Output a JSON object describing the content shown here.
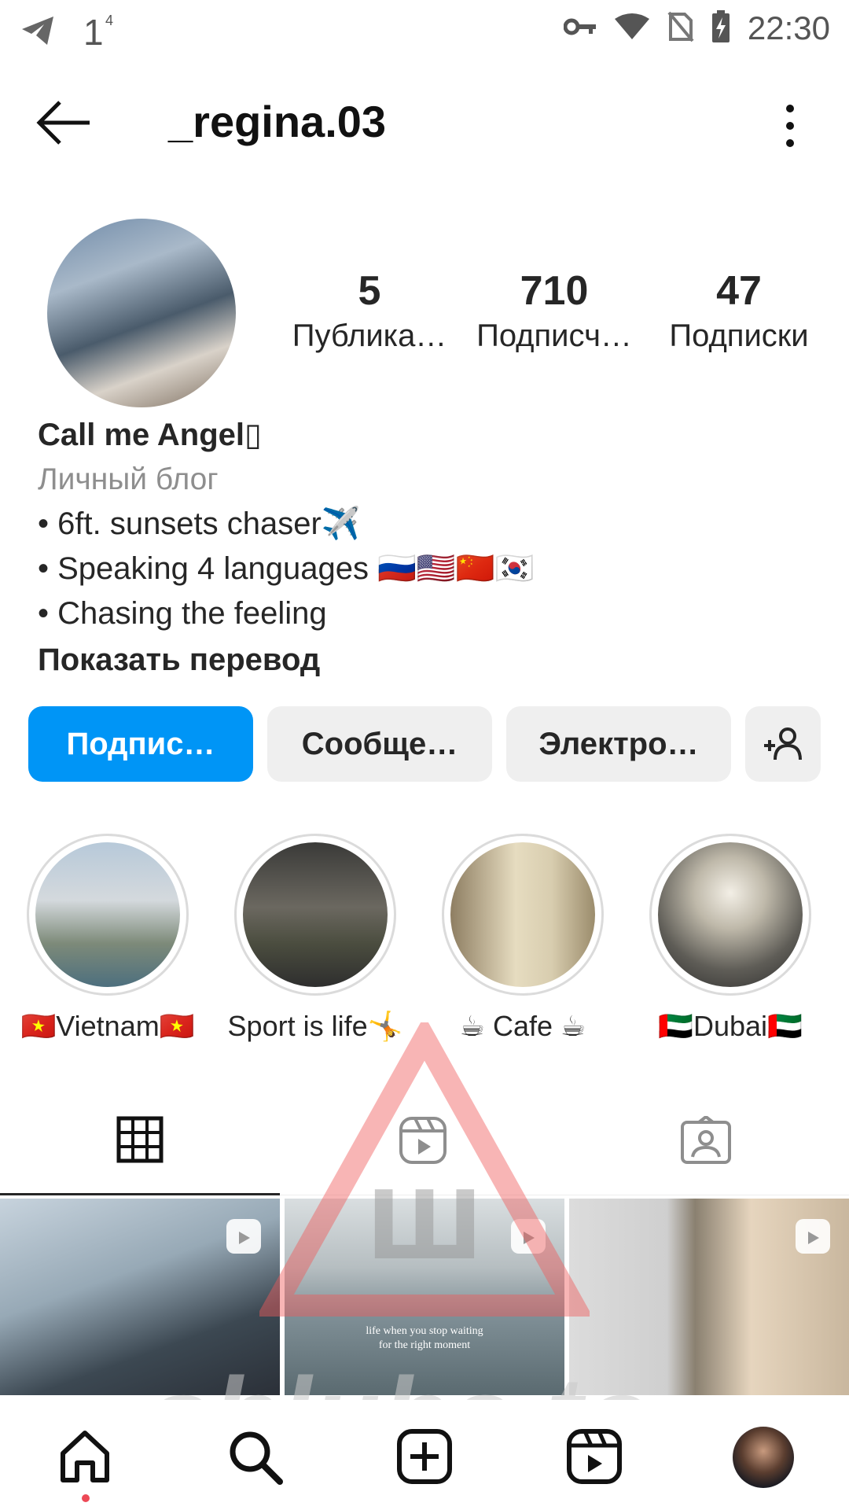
{
  "status_bar": {
    "notification_count": "1",
    "notification_sup": "4",
    "time": "22:30"
  },
  "header": {
    "username": "_regina.03"
  },
  "stats": {
    "posts": {
      "value": "5",
      "label": "Публика…"
    },
    "followers": {
      "value": "710",
      "label": "Подписч…"
    },
    "following": {
      "value": "47",
      "label": "Подписки"
    }
  },
  "bio": {
    "name": "Call me Angel▯",
    "category": "Личный блог",
    "line1": "• 6ft. sunsets chaser✈️",
    "line2": "• Speaking 4 languages 🇷🇺🇺🇸🇨🇳🇰🇷",
    "line3": "• Chasing the feeling",
    "translate": "Показать перевод"
  },
  "actions": {
    "follow": "Подпис…",
    "message": "Сообще…",
    "email": "Электро…"
  },
  "highlights": [
    {
      "label": "🇻🇳Vietnam🇻🇳"
    },
    {
      "label": "Sport is life🤸"
    },
    {
      "label": "☕ Cafe ☕"
    },
    {
      "label": "🇦🇪Dubai🇦🇪"
    }
  ],
  "posts": [
    {
      "caption": ""
    },
    {
      "caption": "life when you stop waiting\nfor the right moment"
    },
    {
      "caption": ""
    }
  ],
  "watermark": {
    "text": "shluha.to",
    "glyph": "Ш"
  },
  "colors": {
    "accent": "#0095f6",
    "button_bg": "#efefef",
    "notification_dot": "#ed4956"
  }
}
